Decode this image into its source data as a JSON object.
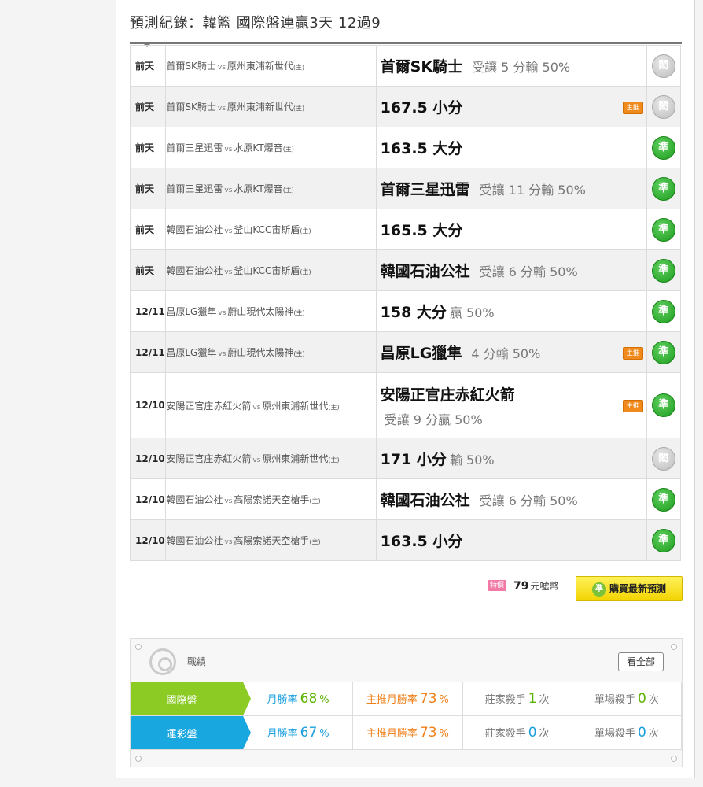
{
  "title": "預測紀錄：韓籃 國際盤連贏3天 12過9",
  "records": [
    {
      "date": "前天",
      "home": "首爾SK騎士",
      "vs": "vs",
      "away": "原州東浦新世代",
      "host": "(主)",
      "pick": "首爾SK騎士",
      "detail": "受讓 5 分輸 50%",
      "main": false,
      "result": "閎",
      "result_type": "push",
      "alt": false
    },
    {
      "date": "前天",
      "home": "首爾SK騎士",
      "vs": "vs",
      "away": "原州東浦新世代",
      "host": "(主)",
      "pick": "167.5 小分",
      "detail": "",
      "main": true,
      "main_label": "主推",
      "result": "閎",
      "result_type": "push",
      "alt": true
    },
    {
      "date": "前天",
      "home": "首爾三星迅雷",
      "vs": "vs",
      "away": "水原KT爆音",
      "host": "(主)",
      "pick": "163.5 大分",
      "detail": "",
      "main": false,
      "result": "準",
      "result_type": "win",
      "alt": false
    },
    {
      "date": "前天",
      "home": "首爾三星迅雷",
      "vs": "vs",
      "away": "水原KT爆音",
      "host": "(主)",
      "pick": "首爾三星迅雷",
      "detail": "受讓 11 分輸 50%",
      "main": false,
      "result": "準",
      "result_type": "win",
      "alt": true
    },
    {
      "date": "前天",
      "home": "韓國石油公社",
      "vs": "vs",
      "away": "釜山KCC宙斯盾",
      "host": "(主)",
      "pick": "165.5 大分",
      "detail": "",
      "main": false,
      "result": "準",
      "result_type": "win",
      "alt": false
    },
    {
      "date": "前天",
      "home": "韓國石油公社",
      "vs": "vs",
      "away": "釜山KCC宙斯盾",
      "host": "(主)",
      "pick": "韓國石油公社",
      "detail": "受讓 6 分輸 50%",
      "main": false,
      "result": "準",
      "result_type": "win",
      "alt": true
    },
    {
      "date": "12/11",
      "home": "昌原LG獵隼",
      "vs": "vs",
      "away": "蔚山現代太陽神",
      "host": "(主)",
      "pick": "158 大分",
      "detail2": "贏 50%",
      "main": false,
      "result": "準",
      "result_type": "win",
      "alt": false
    },
    {
      "date": "12/11",
      "home": "昌原LG獵隼",
      "vs": "vs",
      "away": "蔚山現代太陽神",
      "host": "(主)",
      "pick": "昌原LG獵隼",
      "detail": "4 分輸 50%",
      "main": true,
      "main_label": "主推",
      "result": "準",
      "result_type": "win",
      "alt": true
    },
    {
      "date": "12/10",
      "home": "安陽正官庄赤紅火箭",
      "vs": "vs",
      "away": "原州東浦新世代",
      "host": "(主)",
      "pick": "安陽正官庄赤紅火箭",
      "line2": "受讓 9 分贏 50%",
      "main": true,
      "main_label": "主推",
      "result": "準",
      "result_type": "win",
      "alt": false,
      "tall": true
    },
    {
      "date": "12/10",
      "home": "安陽正官庄赤紅火箭",
      "vs": "vs",
      "away": "原州東浦新世代",
      "host": "(主)",
      "pick": "171 小分",
      "detail2": "輸 50%",
      "main": false,
      "result": "閎",
      "result_type": "push",
      "alt": true
    },
    {
      "date": "12/10",
      "home": "韓國石油公社",
      "vs": "vs",
      "away": "高陽索諾天空槍手",
      "host": "(主)",
      "pick": "韓國石油公社",
      "detail": "受讓 6 分輸 50%",
      "main": false,
      "result": "準",
      "result_type": "win",
      "alt": false
    },
    {
      "date": "12/10",
      "home": "韓國石油公社",
      "vs": "vs",
      "away": "高陽索諾天空槍手",
      "host": "(主)",
      "pick": "163.5 小分",
      "detail": "",
      "main": false,
      "result": "準",
      "result_type": "win",
      "alt": true
    }
  ],
  "buy": {
    "special_label": "特價",
    "price": "79",
    "unit": "元噓幣",
    "button_label": "購買最新預測",
    "button_icon": "準"
  },
  "stats": {
    "label": "戰績",
    "view_all": "看全部",
    "rows": [
      {
        "name": "國際盤",
        "color": "green",
        "monthly_label": "月勝率",
        "monthly": "68",
        "main_label": "主推月勝率",
        "main": "73",
        "pct": "%",
        "banker_label": "莊家殺手",
        "banker": "1",
        "single_label": "單場殺手",
        "single": "0",
        "count_unit": "次"
      },
      {
        "name": "運彩盤",
        "color": "blue",
        "monthly_label": "月勝率",
        "monthly": "67",
        "main_label": "主推月勝率",
        "main": "73",
        "pct": "%",
        "banker_label": "莊家殺手",
        "banker": "0",
        "single_label": "單場殺手",
        "single": "0",
        "count_unit": "次"
      }
    ]
  },
  "colors": {
    "win": "#1e9c1e",
    "push": "#bdbdbd",
    "accent_green": "#8bcb23",
    "accent_blue": "#19a7e0",
    "main_badge": "#f08a1d",
    "buy_button": "#f2d400"
  }
}
